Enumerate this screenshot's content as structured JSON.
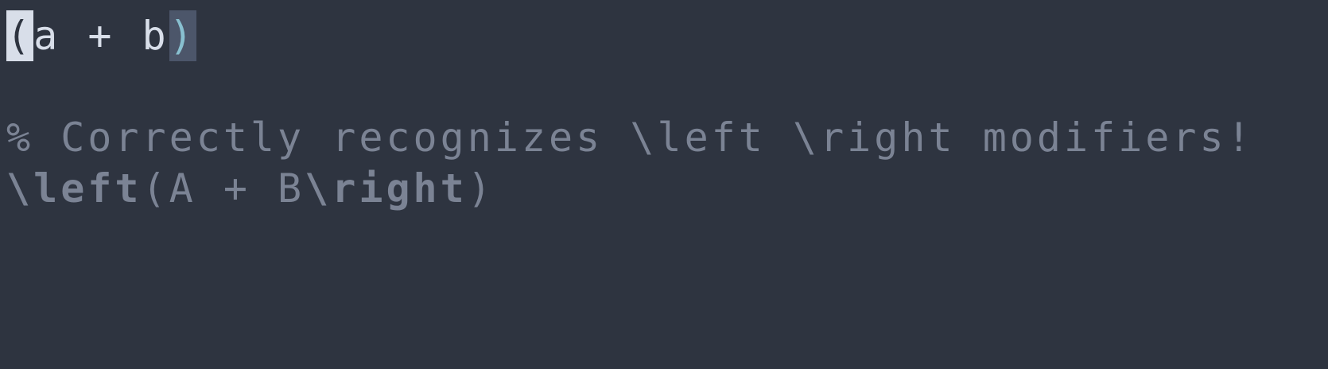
{
  "theme": {
    "background": "#2e3440",
    "foreground": "#d8dee9",
    "cursor_bg": "#d8dee9",
    "match_bg": "#4c566a",
    "match_fg": "#88c0d0",
    "comment_fg": "#7b8394"
  },
  "lines": [
    {
      "cursor_char": "(",
      "body": "a + b",
      "matched_paren": ")"
    },
    {
      "text": ""
    },
    {
      "comment": "% Correctly recognizes \\left \\right modifiers!"
    },
    {
      "kw_left": "\\left",
      "open_paren": "(",
      "body": "A + B",
      "kw_right": "\\right",
      "close_paren": ")"
    }
  ]
}
